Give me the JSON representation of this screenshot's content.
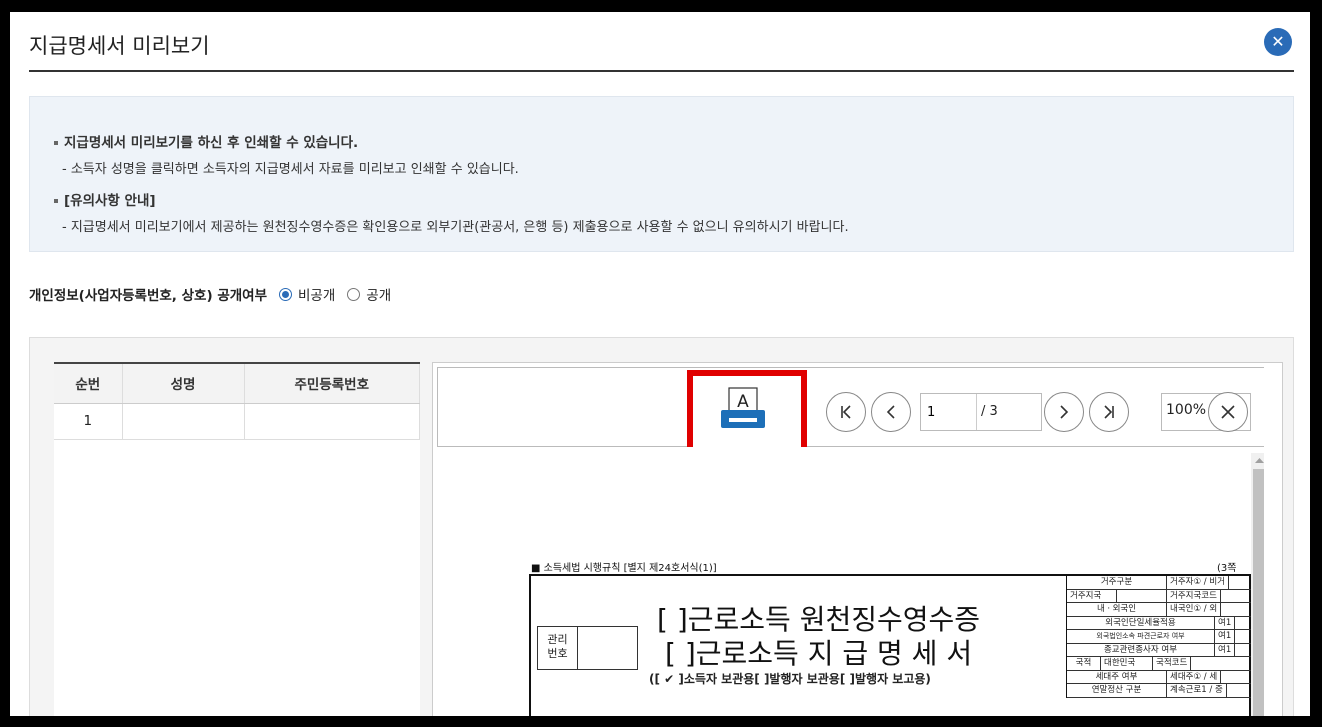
{
  "modal": {
    "title": "지급명세서 미리보기",
    "close_glyph": "✕"
  },
  "notice": {
    "line1": "지급명세서 미리보기를 하신 후 인쇄할 수 있습니다.",
    "line2": "- 소득자 성명을 클릭하면 소득자의 지급명세서 자료를 미리보고 인쇄할 수 있습니다.",
    "line3": "[유의사항 안내]",
    "line4": "- 지급명세서 미리보기에서 제공하는 원천징수영수증은 확인용으로 외부기관(관공서, 은행 등) 제출용으로 사용할 수 없으니 유의하시기 바랍니다."
  },
  "privacy": {
    "label": "개인정보(사업자등록번호, 상호) 공개여부",
    "options": [
      "비공개",
      "공개"
    ],
    "selected": "비공개"
  },
  "list": {
    "headers": [
      "순번",
      "성명",
      "주민등록번호"
    ],
    "rows": [
      {
        "no": "1",
        "name": "",
        "rrn": ""
      }
    ]
  },
  "viewer": {
    "print_icon": "printer-icon",
    "print_glyph": "A",
    "page_current": "1",
    "page_total": "/ 3",
    "zoom": "100%",
    "icons": [
      "first-page-icon",
      "prev-page-icon",
      "next-page-icon",
      "last-page-icon",
      "close-viewer-icon"
    ]
  },
  "document": {
    "header_left": "■ 소득세법 시행규칙 [별지 제24호서식(1)]",
    "header_right": "(3쪽",
    "mgmt_label": "관리\n번호",
    "title1": "[  ]근로소득 원천징수영수증",
    "title2": "[  ]근로소득 지 급 명 세 서",
    "subtitle": "([ ✔ ]소득자 보관용[     ]발행자 보관용[     ]발행자 보고용)",
    "side_rows": [
      [
        "거주구분",
        "거주자① / 비거"
      ],
      [
        "거주지국",
        "거주지국코드"
      ],
      [
        "내ㆍ외국인",
        "내국인① / 외"
      ],
      [
        "외국인단일세율적용",
        "여1"
      ],
      [
        "외국법인소속 파견근로자 여부",
        "여1"
      ],
      [
        "종교관련종사자 여부",
        "여1"
      ],
      [
        "국적",
        "대한민국",
        "국적코드"
      ],
      [
        "세대주 여부",
        "세대주① / 세"
      ],
      [
        "연말정산 구분",
        "계속근로1 / 중"
      ]
    ]
  },
  "colors": {
    "accent": "#2a6bb7",
    "highlight_border": "#e00000",
    "notice_bg": "#eef3f9"
  }
}
